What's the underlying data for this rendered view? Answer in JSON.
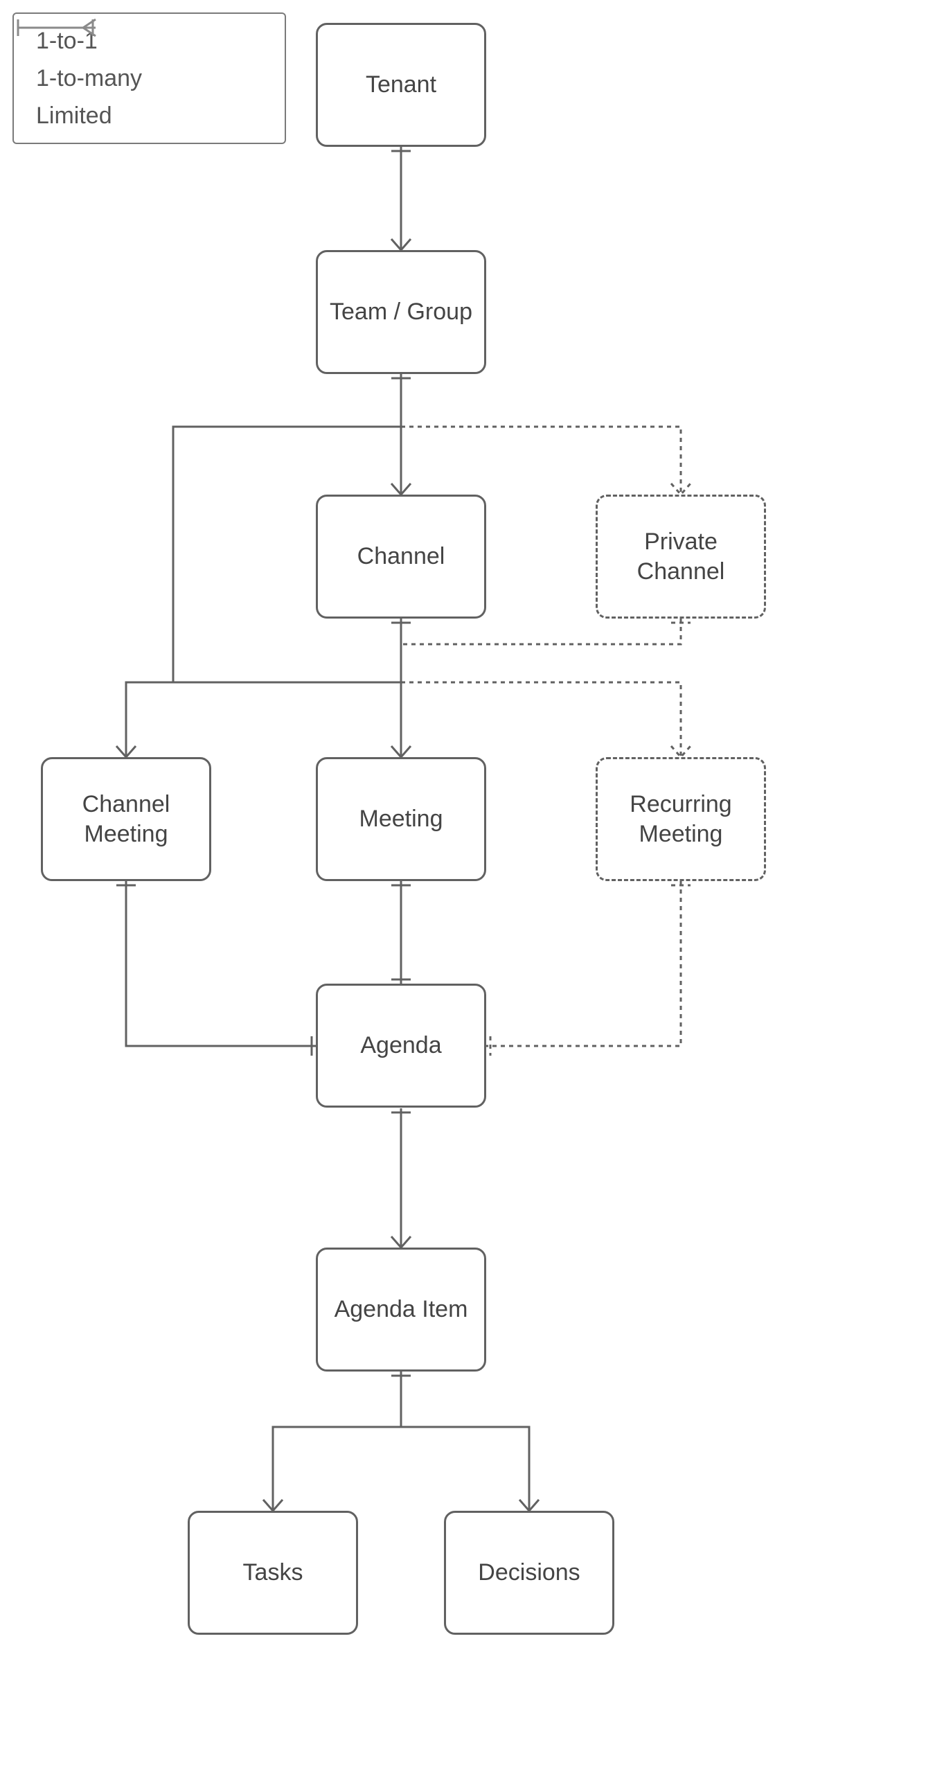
{
  "legend": {
    "one_to_one": "1-to-1",
    "one_to_many": "1-to-many",
    "limited": "Limited"
  },
  "nodes": {
    "tenant": "Tenant",
    "team_group": "Team / Group",
    "channel": "Channel",
    "private_channel": "Private\nChannel",
    "channel_meeting": "Channel\nMeeting",
    "meeting": "Meeting",
    "recurring_meeting": "Recurring\nMeeting",
    "agenda": "Agenda",
    "agenda_item": "Agenda Item",
    "tasks": "Tasks",
    "decisions": "Decisions"
  },
  "relationships": [
    {
      "from": "tenant",
      "to": "team_group",
      "type": "one-to-many",
      "style": "solid"
    },
    {
      "from": "team_group",
      "to": "channel",
      "type": "one-to-many",
      "style": "solid"
    },
    {
      "from": "team_group",
      "to": "private_channel",
      "type": "one-to-many",
      "style": "dotted"
    },
    {
      "from": "channel",
      "to": "meeting",
      "type": "one-to-many",
      "style": "solid"
    },
    {
      "from": "channel",
      "to": "channel_meeting",
      "type": "one-to-many",
      "style": "solid"
    },
    {
      "from": "channel",
      "to": "recurring_meeting",
      "type": "one-to-many",
      "style": "dotted"
    },
    {
      "from": "private_channel",
      "to": "recurring_meeting",
      "type": "limited",
      "style": "dotted"
    },
    {
      "from": "meeting",
      "to": "agenda",
      "type": "one-to-one",
      "style": "solid"
    },
    {
      "from": "channel_meeting",
      "to": "agenda",
      "type": "one-to-one",
      "style": "solid"
    },
    {
      "from": "recurring_meeting",
      "to": "agenda",
      "type": "one-to-one",
      "style": "dotted"
    },
    {
      "from": "agenda",
      "to": "agenda_item",
      "type": "one-to-many",
      "style": "solid"
    },
    {
      "from": "agenda_item",
      "to": "tasks",
      "type": "one-to-many",
      "style": "solid"
    },
    {
      "from": "agenda_item",
      "to": "decisions",
      "type": "one-to-many",
      "style": "solid"
    }
  ]
}
